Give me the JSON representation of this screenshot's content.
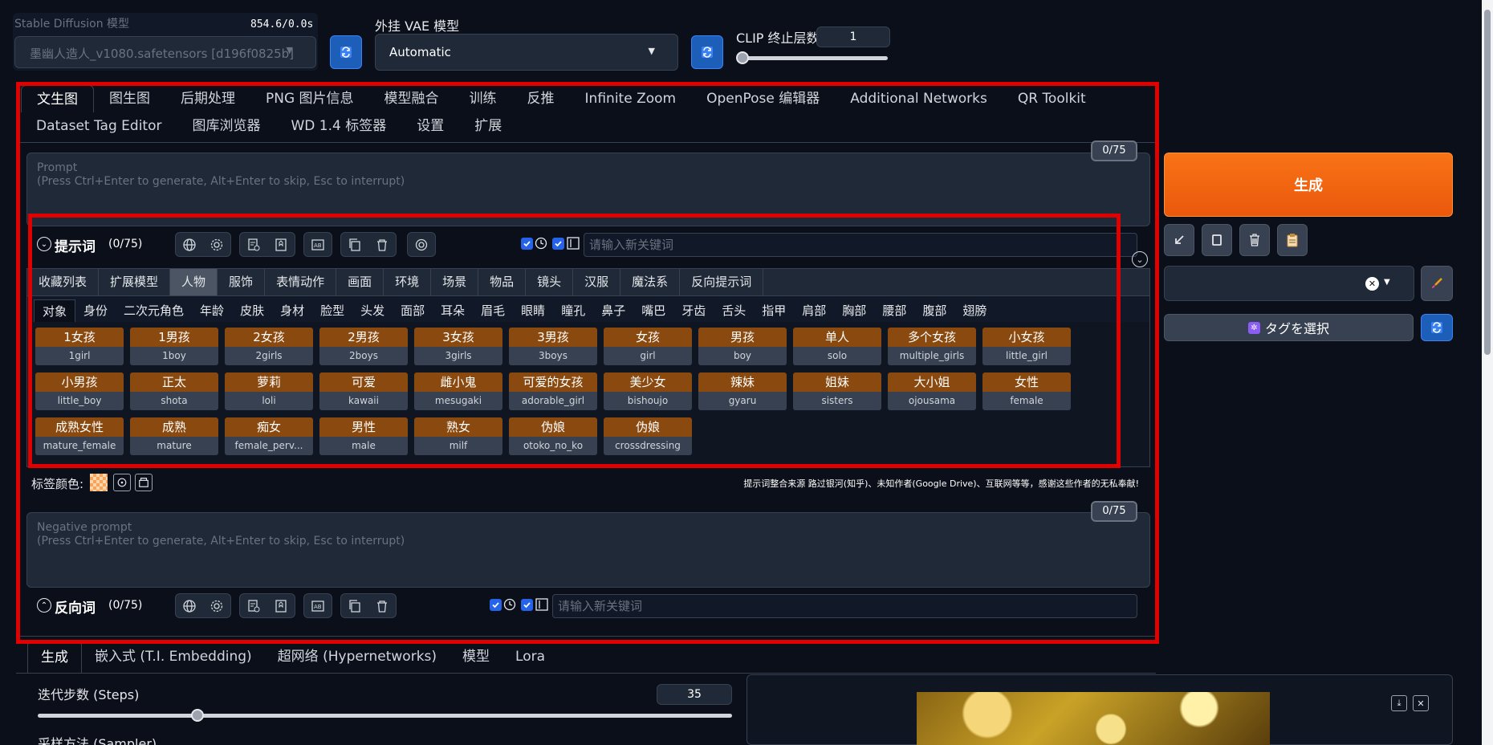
{
  "top": {
    "sd_model_label": "Stable Diffusion 模型",
    "sd_model_timer": "854.6/0.0s",
    "sd_model_value": "墨幽人造人_v1080.safetensors [d196f0825b]",
    "vae_label": "外挂 VAE 模型",
    "vae_value": "Automatic",
    "clip_label": "CLIP 终止层数",
    "clip_value": "1"
  },
  "main_tabs": [
    "文生图",
    "图生图",
    "后期处理",
    "PNG 图片信息",
    "模型融合",
    "训练",
    "反推",
    "Infinite Zoom",
    "OpenPose 编辑器",
    "Additional Networks",
    "QR Toolkit",
    "Dataset Tag Editor",
    "图库浏览器",
    "WD 1.4 标签器",
    "设置",
    "扩展"
  ],
  "prompt": {
    "counter": "0/75",
    "placeholder_line1": "Prompt",
    "placeholder_line2": "(Press Ctrl+Enter to generate, Alt+Enter to skip, Esc to interrupt)"
  },
  "prompt_tools": {
    "title": "提示词",
    "count": "(0/75)",
    "keyword_placeholder": "请输入新关键词"
  },
  "categories": [
    "收藏列表",
    "扩展模型",
    "人物",
    "服饰",
    "表情动作",
    "画面",
    "环境",
    "场景",
    "物品",
    "镜头",
    "汉服",
    "魔法系",
    "反向提示词"
  ],
  "subcategories": [
    "对象",
    "身份",
    "二次元角色",
    "年龄",
    "皮肤",
    "身材",
    "脸型",
    "头发",
    "面部",
    "耳朵",
    "眉毛",
    "眼睛",
    "瞳孔",
    "鼻子",
    "嘴巴",
    "牙齿",
    "舌头",
    "指甲",
    "肩部",
    "胸部",
    "腰部",
    "腹部",
    "翅膀"
  ],
  "tags": [
    {
      "cn": "1女孩",
      "en": "1girl"
    },
    {
      "cn": "1男孩",
      "en": "1boy"
    },
    {
      "cn": "2女孩",
      "en": "2girls"
    },
    {
      "cn": "2男孩",
      "en": "2boys"
    },
    {
      "cn": "3女孩",
      "en": "3girls"
    },
    {
      "cn": "3男孩",
      "en": "3boys"
    },
    {
      "cn": "女孩",
      "en": "girl"
    },
    {
      "cn": "男孩",
      "en": "boy"
    },
    {
      "cn": "单人",
      "en": "solo"
    },
    {
      "cn": "多个女孩",
      "en": "multiple_girls"
    },
    {
      "cn": "小女孩",
      "en": "little_girl"
    },
    {
      "cn": "小男孩",
      "en": "little_boy"
    },
    {
      "cn": "正太",
      "en": "shota"
    },
    {
      "cn": "萝莉",
      "en": "loli"
    },
    {
      "cn": "可爱",
      "en": "kawaii"
    },
    {
      "cn": "雌小鬼",
      "en": "mesugaki"
    },
    {
      "cn": "可爱的女孩",
      "en": "adorable_girl"
    },
    {
      "cn": "美少女",
      "en": "bishoujo"
    },
    {
      "cn": "辣妹",
      "en": "gyaru"
    },
    {
      "cn": "姐妹",
      "en": "sisters"
    },
    {
      "cn": "大小姐",
      "en": "ojousama"
    },
    {
      "cn": "女性",
      "en": "female"
    },
    {
      "cn": "成熟女性",
      "en": "mature_female"
    },
    {
      "cn": "成熟",
      "en": "mature"
    },
    {
      "cn": "痴女",
      "en": "female_perv..."
    },
    {
      "cn": "男性",
      "en": "male"
    },
    {
      "cn": "熟女",
      "en": "milf"
    },
    {
      "cn": "伪娘",
      "en": "otoko_no_ko"
    },
    {
      "cn": "伪娘",
      "en": "crossdressing"
    }
  ],
  "tag_color": {
    "label": "标签颜色:",
    "credits": "提示词整合来源 路过银河(知乎)、未知作者(Google Drive)、互联网等等，感谢这些作者的无私奉献!"
  },
  "negative": {
    "counter": "0/75",
    "placeholder_line1": "Negative prompt",
    "placeholder_line2": "(Press Ctrl+Enter to generate, Alt+Enter to skip, Esc to interrupt)"
  },
  "neg_tools": {
    "title": "反向词",
    "count": "(0/75)",
    "keyword_placeholder": "请输入新关键词"
  },
  "right": {
    "generate_label": "生成",
    "select_tags_label": "タグを選択"
  },
  "bottom_tabs": [
    "生成",
    "嵌入式 (T.I. Embedding)",
    "超网络 (Hypernetworks)",
    "模型",
    "Lora"
  ],
  "steps": {
    "label": "迭代步数 (Steps)",
    "value": "35",
    "fraction": 0.23
  },
  "sampler_label": "采样方法 (Sampler)",
  "colors": {
    "generate": "#f97316",
    "accent_red": "#e00000",
    "tag_orange": "#8a4a0f"
  }
}
